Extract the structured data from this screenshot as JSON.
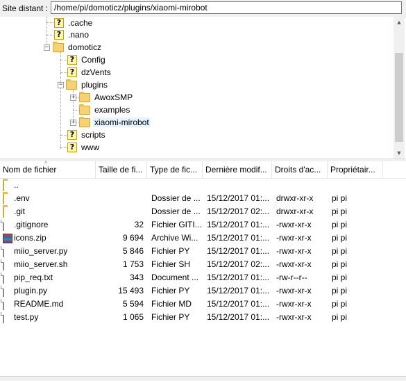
{
  "pathbar": {
    "label": "Site distant :",
    "path": "/home/pi/domoticz/plugins/xiaomi-mirobot"
  },
  "tree": {
    "items": [
      {
        "label": ".cache",
        "icon": "question-icon"
      },
      {
        "label": ".nano",
        "icon": "question-icon"
      },
      {
        "label": "domoticz",
        "icon": "folder-icon"
      },
      {
        "label": "Config",
        "icon": "question-icon"
      },
      {
        "label": "dzVents",
        "icon": "question-icon"
      },
      {
        "label": "plugins",
        "icon": "folder-icon"
      },
      {
        "label": "AwoxSMP",
        "icon": "folder-icon"
      },
      {
        "label": "examples",
        "icon": "folder-icon"
      },
      {
        "label": "xiaomi-mirobot",
        "icon": "folder-icon",
        "selected": true
      },
      {
        "label": "scripts",
        "icon": "question-icon"
      },
      {
        "label": "www",
        "icon": "question-icon"
      }
    ]
  },
  "list": {
    "headers": {
      "name": "Nom de fichier",
      "size": "Taille de fi...",
      "type": "Type de fic...",
      "modified": "Dernière modif...",
      "perms": "Droits d'ac...",
      "owner": "Propriétair..."
    },
    "rows": [
      {
        "icon": "folder-icon",
        "name": "..",
        "size": "",
        "type": "",
        "modified": "",
        "perms": "",
        "owner": ""
      },
      {
        "icon": "folder-icon",
        "name": ".env",
        "size": "",
        "type": "Dossier de ...",
        "modified": "15/12/2017 01:...",
        "perms": "drwxr-xr-x",
        "owner": "pi pi"
      },
      {
        "icon": "folder-icon",
        "name": ".git",
        "size": "",
        "type": "Dossier de ...",
        "modified": "15/12/2017 02:...",
        "perms": "drwxr-xr-x",
        "owner": "pi pi"
      },
      {
        "icon": "document-icon",
        "name": ".gitignore",
        "size": "32",
        "type": "Fichier GITI...",
        "modified": "15/12/2017 01:...",
        "perms": "-rwxr-xr-x",
        "owner": "pi pi"
      },
      {
        "icon": "archive-icon",
        "name": "icons.zip",
        "size": "9 694",
        "type": "Archive Wi...",
        "modified": "15/12/2017 01:...",
        "perms": "-rwxr-xr-x",
        "owner": "pi pi"
      },
      {
        "icon": "document-icon",
        "name": "miio_server.py",
        "size": "5 846",
        "type": "Fichier PY",
        "modified": "15/12/2017 01:...",
        "perms": "-rwxr-xr-x",
        "owner": "pi pi"
      },
      {
        "icon": "document-icon",
        "name": "miio_server.sh",
        "size": "1 753",
        "type": "Fichier SH",
        "modified": "15/12/2017 02:...",
        "perms": "-rwxr-xr-x",
        "owner": "pi pi"
      },
      {
        "icon": "document-icon",
        "name": "pip_req.txt",
        "size": "343",
        "type": "Document ...",
        "modified": "15/12/2017 01:...",
        "perms": "-rw-r--r--",
        "owner": "pi pi"
      },
      {
        "icon": "document-icon",
        "name": "plugin.py",
        "size": "15 493",
        "type": "Fichier PY",
        "modified": "15/12/2017 01:...",
        "perms": "-rwxr-xr-x",
        "owner": "pi pi"
      },
      {
        "icon": "document-icon",
        "name": "README.md",
        "size": "5 594",
        "type": "Fichier MD",
        "modified": "15/12/2017 01:...",
        "perms": "-rwxr-xr-x",
        "owner": "pi pi"
      },
      {
        "icon": "document-icon",
        "name": "test.py",
        "size": "1 065",
        "type": "Fichier PY",
        "modified": "15/12/2017 01:...",
        "perms": "-rwxr-xr-x",
        "owner": "pi pi"
      }
    ]
  }
}
